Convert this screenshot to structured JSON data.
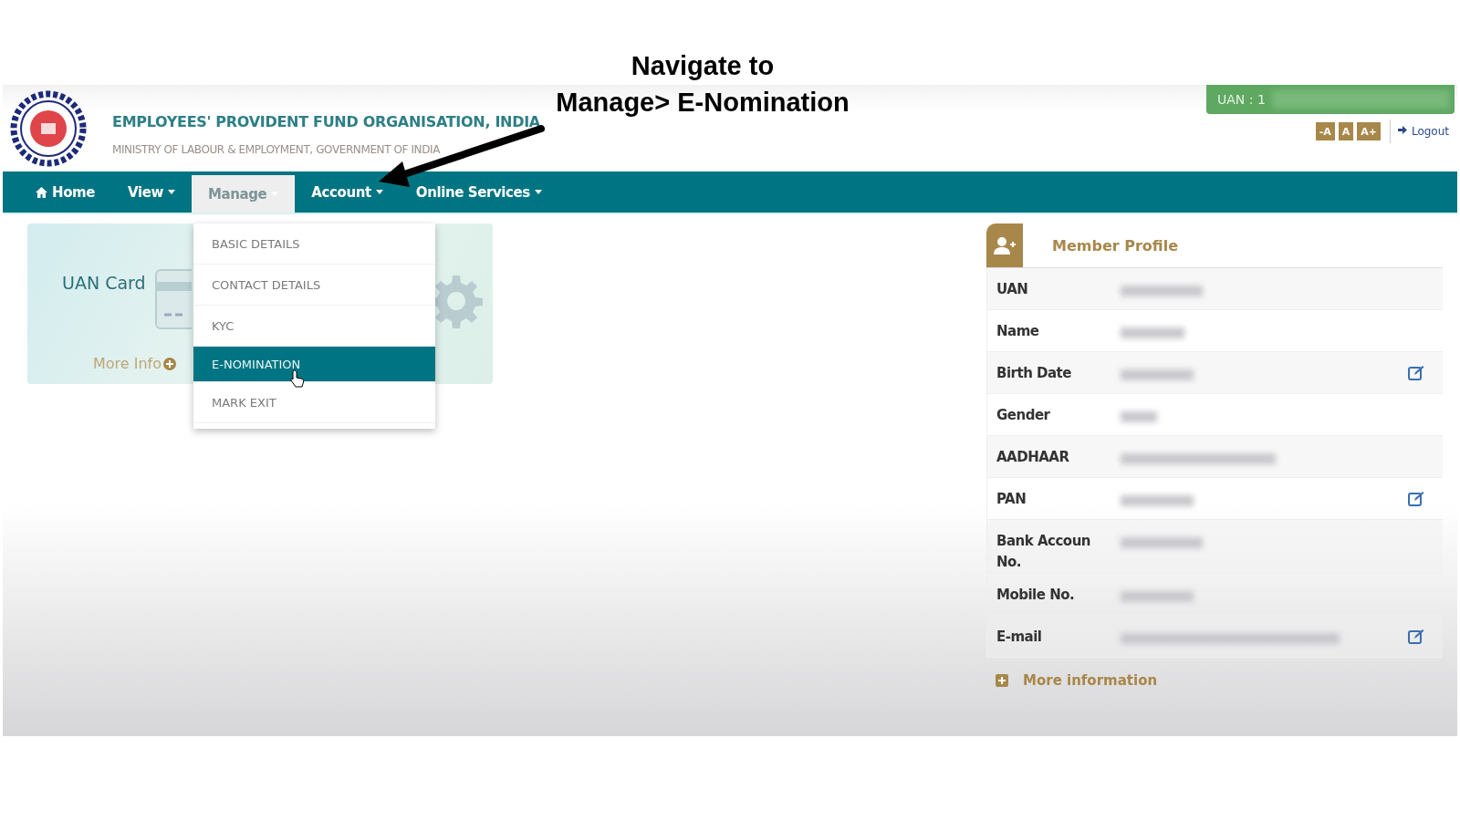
{
  "annotation": {
    "lines": [
      "Navigate to",
      "Manage> E-Nomination"
    ]
  },
  "header": {
    "title": "EMPLOYEES' PROVIDENT FUND ORGANISATION, INDIA",
    "subtitle": "MINISTRY OF LABOUR & EMPLOYMENT, GOVERNMENT OF INDIA",
    "uan_label": "UAN : 1",
    "font_buttons": [
      "-A",
      "A",
      "A+"
    ],
    "logout": "Logout"
  },
  "nav": [
    {
      "label": "Home",
      "kind": "home",
      "selected": false
    },
    {
      "label": "View",
      "kind": "menu",
      "selected": false
    },
    {
      "label": "Manage",
      "kind": "menu",
      "selected": true
    },
    {
      "label": "Account",
      "kind": "menu",
      "selected": false
    },
    {
      "label": "Online Services",
      "kind": "menu",
      "selected": false
    }
  ],
  "dropdown": [
    {
      "label": "BASIC DETAILS",
      "selected": false
    },
    {
      "label": "CONTACT DETAILS",
      "selected": false
    },
    {
      "label": "KYC",
      "selected": false
    },
    {
      "label": "E-NOMINATION",
      "selected": true
    },
    {
      "label": "MARK EXIT",
      "selected": false
    }
  ],
  "uan_card": {
    "title": "UAN Card",
    "link": "More Info"
  },
  "profile": {
    "title": "Member Profile",
    "rows": [
      {
        "label": "UAN",
        "edit": false
      },
      {
        "label": "Name",
        "edit": false
      },
      {
        "label": "Birth Date",
        "edit": true
      },
      {
        "label": "Gender",
        "edit": false
      },
      {
        "label": "AADHAAR",
        "edit": false
      },
      {
        "label": "PAN",
        "edit": true
      },
      {
        "label": "Bank Accoun No.",
        "edit": false
      },
      {
        "label": "Mobile No.",
        "edit": false
      },
      {
        "label": "E-mail",
        "edit": true
      }
    ],
    "more": "More information"
  }
}
